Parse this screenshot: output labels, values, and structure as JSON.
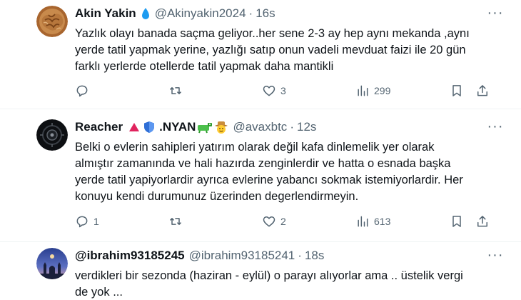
{
  "tweets": [
    {
      "name": "Akin Yakin",
      "handle": "@Akinyakin2024",
      "time": "16s",
      "text_lines": [
        "Yazlık olayı banada saçma geliyor..her sene 2-3 ay hep aynı mekanda ,aynı",
        "yerde tatil yapmak yerine, yazlığı satıp onun vadeli mevduat faizi ile 20 gün",
        "farklı yerlerde otellerde tatil yapmak daha mantikli"
      ],
      "replies": "",
      "reposts": "",
      "likes": "3",
      "views": "299"
    },
    {
      "name": "Reacher",
      "name_suffix": ".NYAN",
      "handle": "@avaxbtc",
      "time": "12s",
      "text_lines": [
        "Belki o evlerin sahipleri yatırım olarak değil kafa dinlemelik yer olarak",
        "almıştır zamanında ve hali hazırda zenginlerdir ve hatta o esnada başka",
        "yerde tatil yapiyorlardir ayrıca evlerine yabancı sokmak istemiyorlardir. Her",
        "konuyu kendi durumunuz üzerinden degerlendirmeyin."
      ],
      "replies": "1",
      "reposts": "",
      "likes": "2",
      "views": "613"
    },
    {
      "name": "@ibrahim93185245",
      "handle": "@ibrahim93185241",
      "time": "18s",
      "text_lines": [
        "verdikleri bir sezonda (haziran - eylül) o parayı alıyorlar ama .. üstelik vergi",
        "de yok ..."
      ]
    }
  ],
  "separator": "·",
  "more_glyph": "···",
  "colors": {
    "text": "#0f1419",
    "secondary": "#536471",
    "divider": "#eff3f4",
    "verified_blue": "#1d9bf0"
  },
  "icons": [
    "verified-drop-icon",
    "red-triangle-icon",
    "blue-shield-icon",
    "frog-emoji-icon",
    "cowboy-emoji-icon",
    "more-icon",
    "reply-icon",
    "repost-icon",
    "like-icon",
    "views-icon",
    "bookmark-icon",
    "share-icon"
  ]
}
